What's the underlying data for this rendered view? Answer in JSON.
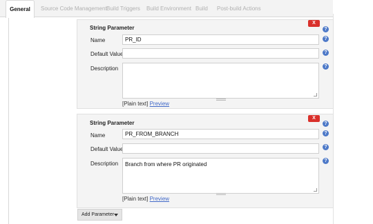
{
  "tabs": [
    {
      "label": "General",
      "active": true
    },
    {
      "label": "Source Code Management",
      "active": false
    },
    {
      "label": "Build Triggers",
      "active": false
    },
    {
      "label": "Build Environment",
      "active": false
    },
    {
      "label": "Build",
      "active": false
    },
    {
      "label": "Post-build Actions",
      "active": false
    }
  ],
  "delete_label": "X",
  "help_glyph": "?",
  "params": [
    {
      "title": "String Parameter",
      "name_label": "Name",
      "name_value": "PR_ID",
      "default_label": "Default Value",
      "default_value": "",
      "description_label": "Description",
      "description_value": "",
      "plain_text": "[Plain text]",
      "preview": "Preview"
    },
    {
      "title": "String Parameter",
      "name_label": "Name",
      "name_value": "PR_FROM_BRANCH",
      "default_label": "Default Value",
      "default_value": "",
      "description_label": "Description",
      "description_value": "Branch from where PR originated",
      "plain_text": "[Plain text]",
      "preview": "Preview"
    }
  ],
  "add_parameter_label": "Add Parameter",
  "colors": {
    "delete": "#d9302b",
    "help": "#4d79c8",
    "link": "#4169c8",
    "panel": "#f4f4f4"
  }
}
